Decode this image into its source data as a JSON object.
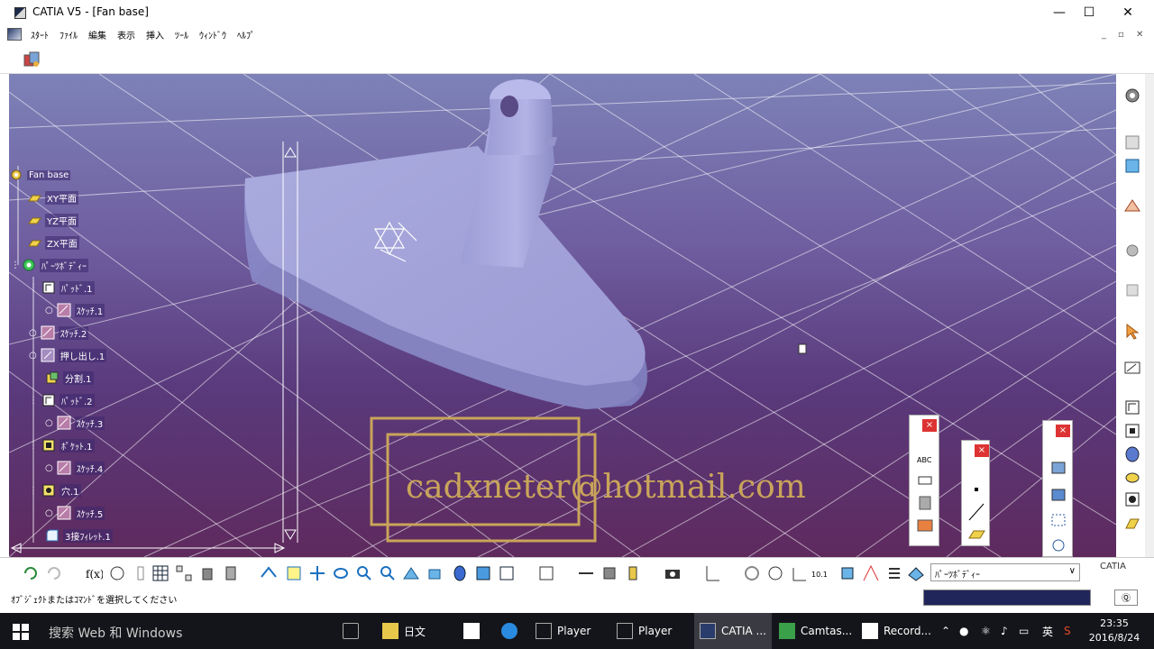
{
  "window": {
    "title": "CATIA V5 - [Fan base]",
    "minimize": "—",
    "maximize": "☐",
    "close": "✕"
  },
  "menu": {
    "items": [
      "ｽﾀｰﾄ",
      "ﾌｧｲﾙ",
      "編集",
      "表示",
      "挿入",
      "ﾂｰﾙ",
      "ｳｨﾝﾄﾞｳ",
      "ﾍﾙﾌﾟ"
    ],
    "mdi": [
      "_",
      "▫",
      "✕"
    ]
  },
  "tree": {
    "root": "Fan base",
    "nodes": [
      {
        "label": "XY平面",
        "icon": "plane-icon"
      },
      {
        "label": "YZ平面",
        "icon": "plane-icon"
      },
      {
        "label": "ZX平面",
        "icon": "plane-icon"
      },
      {
        "label": "ﾊﾟｰﾂﾎﾞﾃﾞｨｰ",
        "icon": "partbody-icon"
      },
      {
        "label": "ﾊﾟｯﾄﾞ.1",
        "icon": "pad-icon"
      },
      {
        "label": "ｽｹｯﾁ.1",
        "icon": "sketch-icon"
      },
      {
        "label": "ｽｹｯﾁ.2",
        "icon": "sketch-icon"
      },
      {
        "label": "押し出し.1",
        "icon": "extrude-icon"
      },
      {
        "label": "分割.1",
        "icon": "split-icon"
      },
      {
        "label": "ﾊﾟｯﾄﾞ.2",
        "icon": "pad-icon"
      },
      {
        "label": "ｽｹｯﾁ.3",
        "icon": "sketch-icon"
      },
      {
        "label": "ﾎﾟｹｯﾄ.1",
        "icon": "pocket-icon"
      },
      {
        "label": "ｽｹｯﾁ.4",
        "icon": "sketch-icon"
      },
      {
        "label": "穴.1",
        "icon": "hole-icon"
      },
      {
        "label": "ｽｹｯﾁ.5",
        "icon": "sketch-icon"
      },
      {
        "label": "3接ﾌｨﾚｯﾄ.1",
        "icon": "fillet-icon"
      }
    ]
  },
  "watermark": "cadxneter@hotmail.com",
  "bottom": {
    "current_body": "ﾊﾟｰﾂﾎﾞﾃﾞｨｰ",
    "select_arrow": "∨"
  },
  "status": {
    "message": "ｵﾌﾞｼﾞｪｸﾄまたはｺﾏﾝﾄﾞを選択してください",
    "btn": "Ⓠ"
  },
  "taskbar": {
    "search": "搜索 Web 和 Windows",
    "apps": [
      {
        "label": "日文"
      },
      {
        "label": "Player"
      },
      {
        "label": "Player"
      },
      {
        "label": "CATIA ..."
      },
      {
        "label": "Camtas..."
      },
      {
        "label": "Record..."
      }
    ],
    "ime": "英",
    "time": "23:35",
    "date": "2016/8/24"
  },
  "brand": "CATIA"
}
